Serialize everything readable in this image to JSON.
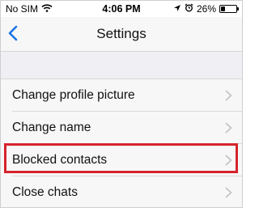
{
  "status_bar": {
    "carrier": "No SIM",
    "time": "4:06 PM",
    "battery_percent": "26%",
    "battery_level": 0.26,
    "icons": [
      "wifi-icon",
      "location-icon",
      "alarm-icon",
      "battery-icon"
    ]
  },
  "nav": {
    "back_icon": "chevron-left-icon",
    "title": "Settings"
  },
  "list": {
    "items": [
      {
        "label": "Change profile picture"
      },
      {
        "label": "Change name"
      },
      {
        "label": "Blocked contacts"
      },
      {
        "label": "Close chats"
      }
    ]
  },
  "colors": {
    "accent": "#1a73e8",
    "highlight": "#d6232b",
    "section_background": "#efeff4",
    "row_background": "#f7f7f7"
  }
}
